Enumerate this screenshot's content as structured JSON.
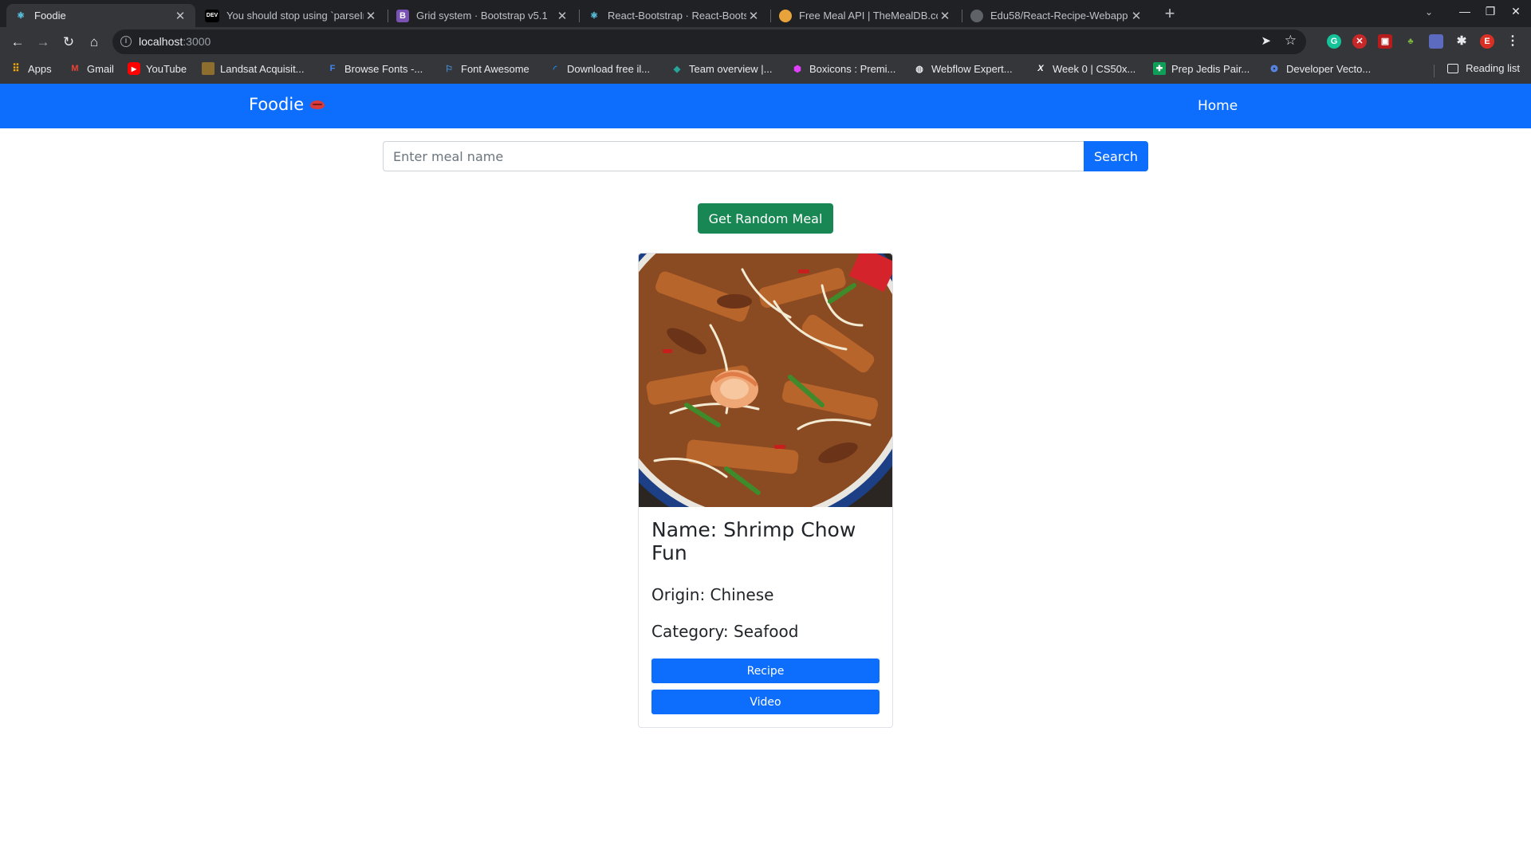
{
  "browser": {
    "tabs": [
      {
        "title": "Foodie",
        "favicon": "react-icon",
        "active": true
      },
      {
        "title": "You should stop using `parseInt()`",
        "favicon": "dev-icon",
        "active": false
      },
      {
        "title": "Grid system · Bootstrap v5.1",
        "favicon": "bootstrap-icon",
        "active": false
      },
      {
        "title": "React-Bootstrap · React-Bootstrap",
        "favicon": "react-icon",
        "active": false
      },
      {
        "title": "Free Meal API | TheMealDB.com",
        "favicon": "mealdb-icon",
        "active": false
      },
      {
        "title": "Edu58/React-Recipe-Webapp",
        "favicon": "github-icon",
        "active": false
      }
    ],
    "url_host": "localhost",
    "url_port": ":3000",
    "profile_initial": "E",
    "bookmarks": [
      {
        "label": "Apps",
        "icon": "apps-grid-icon"
      },
      {
        "label": "Gmail",
        "icon": "gmail-icon"
      },
      {
        "label": "YouTube",
        "icon": "youtube-icon"
      },
      {
        "label": "Landsat Acquisit...",
        "icon": "landsat-icon"
      },
      {
        "label": "Browse Fonts -...",
        "icon": "google-fonts-icon"
      },
      {
        "label": "Font Awesome",
        "icon": "font-awesome-icon"
      },
      {
        "label": "Download free il...",
        "icon": "download-icon"
      },
      {
        "label": "Team overview |...",
        "icon": "team-icon"
      },
      {
        "label": "Boxicons : Premi...",
        "icon": "boxicons-icon"
      },
      {
        "label": "Webflow Expert...",
        "icon": "webflow-icon"
      },
      {
        "label": "Week 0 | CS50x...",
        "icon": "cs50-icon"
      },
      {
        "label": "Prep Jedis Pair...",
        "icon": "sheets-icon"
      },
      {
        "label": "Developer Vecto...",
        "icon": "vector-icon"
      }
    ],
    "reading_list": "Reading list"
  },
  "app": {
    "brand": "Foodie",
    "nav_home": "Home",
    "search_placeholder": "Enter meal name",
    "search_button": "Search",
    "random_button": "Get Random Meal",
    "card": {
      "title": "Name: Shrimp Chow Fun",
      "origin": "Origin: Chinese",
      "category": "Category: Seafood",
      "recipe_button": "Recipe",
      "video_button": "Video"
    }
  },
  "colors": {
    "primary": "#0d6efd",
    "success": "#198754",
    "chrome_dark": "#202124",
    "chrome_toolbar": "#35363a"
  }
}
